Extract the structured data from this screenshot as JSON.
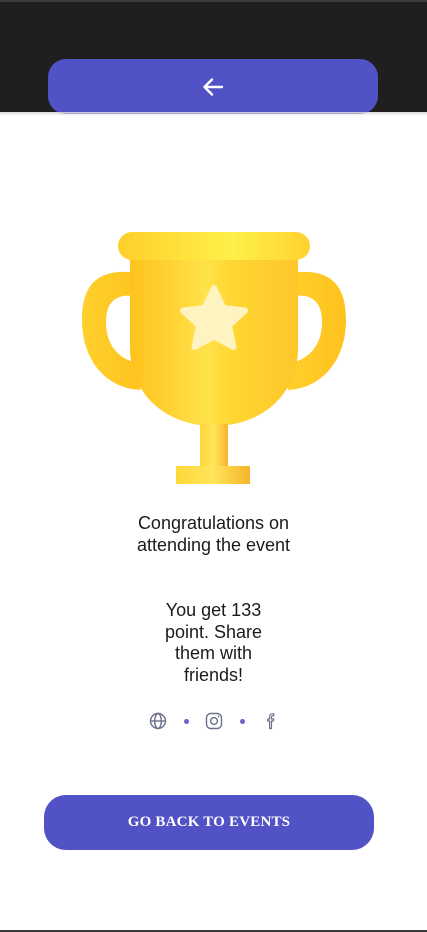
{
  "header": {
    "back_icon": "arrow-left-icon",
    "accent_color": "#5052c6",
    "bar_color": "#1f1f1f"
  },
  "main": {
    "trophy_icon": "trophy-icon",
    "congrats_lines": [
      "Congratulations on",
      "attending the event"
    ],
    "points_lines": [
      "You get 133",
      "point. Share",
      "them with",
      "friends!"
    ]
  },
  "social": {
    "icons": [
      "globe-icon",
      "instagram-icon",
      "facebook-icon"
    ],
    "icon_color": "#6b6f8a",
    "dot_color": "#6a62c9"
  },
  "footer": {
    "go_back_label": "GO BACK TO EVENTS"
  }
}
